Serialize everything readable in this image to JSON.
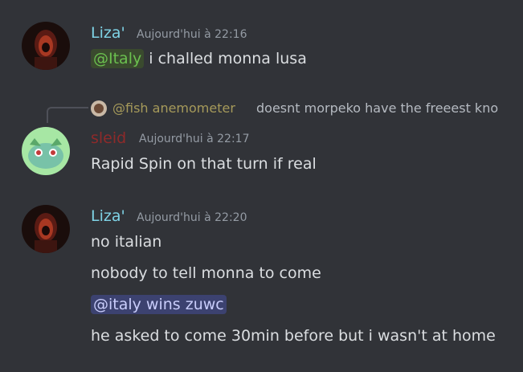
{
  "colors": {
    "background": "#313338",
    "liza_name": "#7fd3e6",
    "sleid_name": "#8e2a2a",
    "fish_name": "#a69a5a",
    "mention_green_bg": "#3a4a2e",
    "mention_green_fg": "#6bc04f",
    "mention_blue_bg": "#3c4270",
    "mention_blue_fg": "#c9cdfb"
  },
  "messages": [
    {
      "author": "Liza'",
      "timestamp": "Aujourd'hui à 22:16",
      "mention": "@Italy",
      "text": " i challed monna lusa"
    },
    {
      "reply": {
        "author": "@fish anemometer",
        "text": "doesnt morpeko have the freeest kno"
      },
      "author": "sleid",
      "timestamp": "Aujourd'hui à 22:17",
      "text": "Rapid Spin on that turn if real"
    },
    {
      "author": "Liza'",
      "timestamp": "Aujourd'hui à 22:20",
      "lines": [
        "no italian",
        "nobody to tell monna to come",
        "@italy wins zuwc",
        "he asked to come 30min before but i wasn't at home"
      ]
    }
  ]
}
